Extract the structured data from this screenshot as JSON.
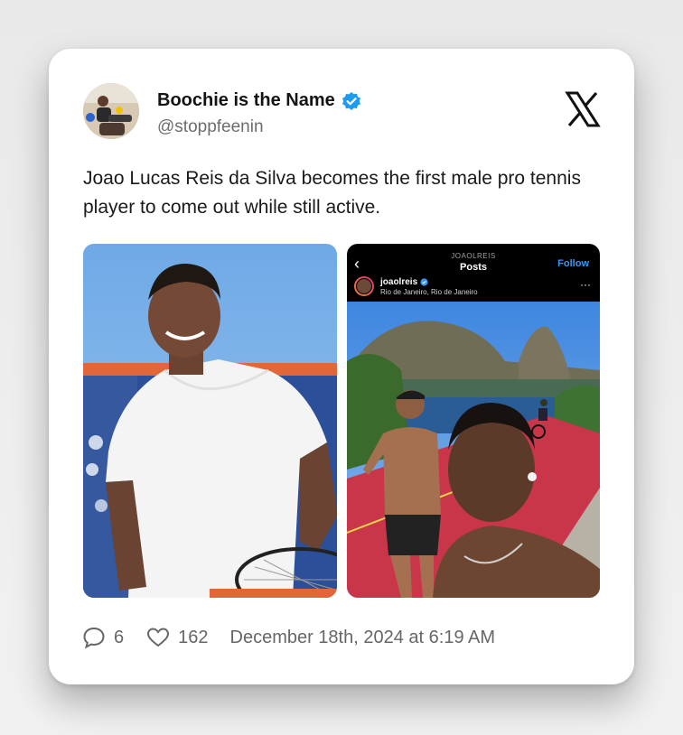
{
  "tweet": {
    "display_name": "Boochie is the Name",
    "handle": "@stoppfeenin",
    "text": "Joao Lucas Reis da Silva becomes the first male pro tennis player to come out while still active.",
    "replies": "6",
    "likes": "162",
    "timestamp": "December 18th, 2024 at 6:19 AM"
  },
  "embedded_post": {
    "top_username": "JOAOLREIS",
    "title": "Posts",
    "follow_label": "Follow",
    "username": "joaolreis",
    "location": "Rio de Janeiro, Rio de Janeiro"
  },
  "icons": {
    "verified": "verified-badge-icon",
    "platform": "x-logo-icon",
    "reply": "speech-bubble-icon",
    "like": "heart-icon"
  },
  "colors": {
    "verified": "#1d9bf0",
    "instagram_follow": "#3897f0"
  }
}
